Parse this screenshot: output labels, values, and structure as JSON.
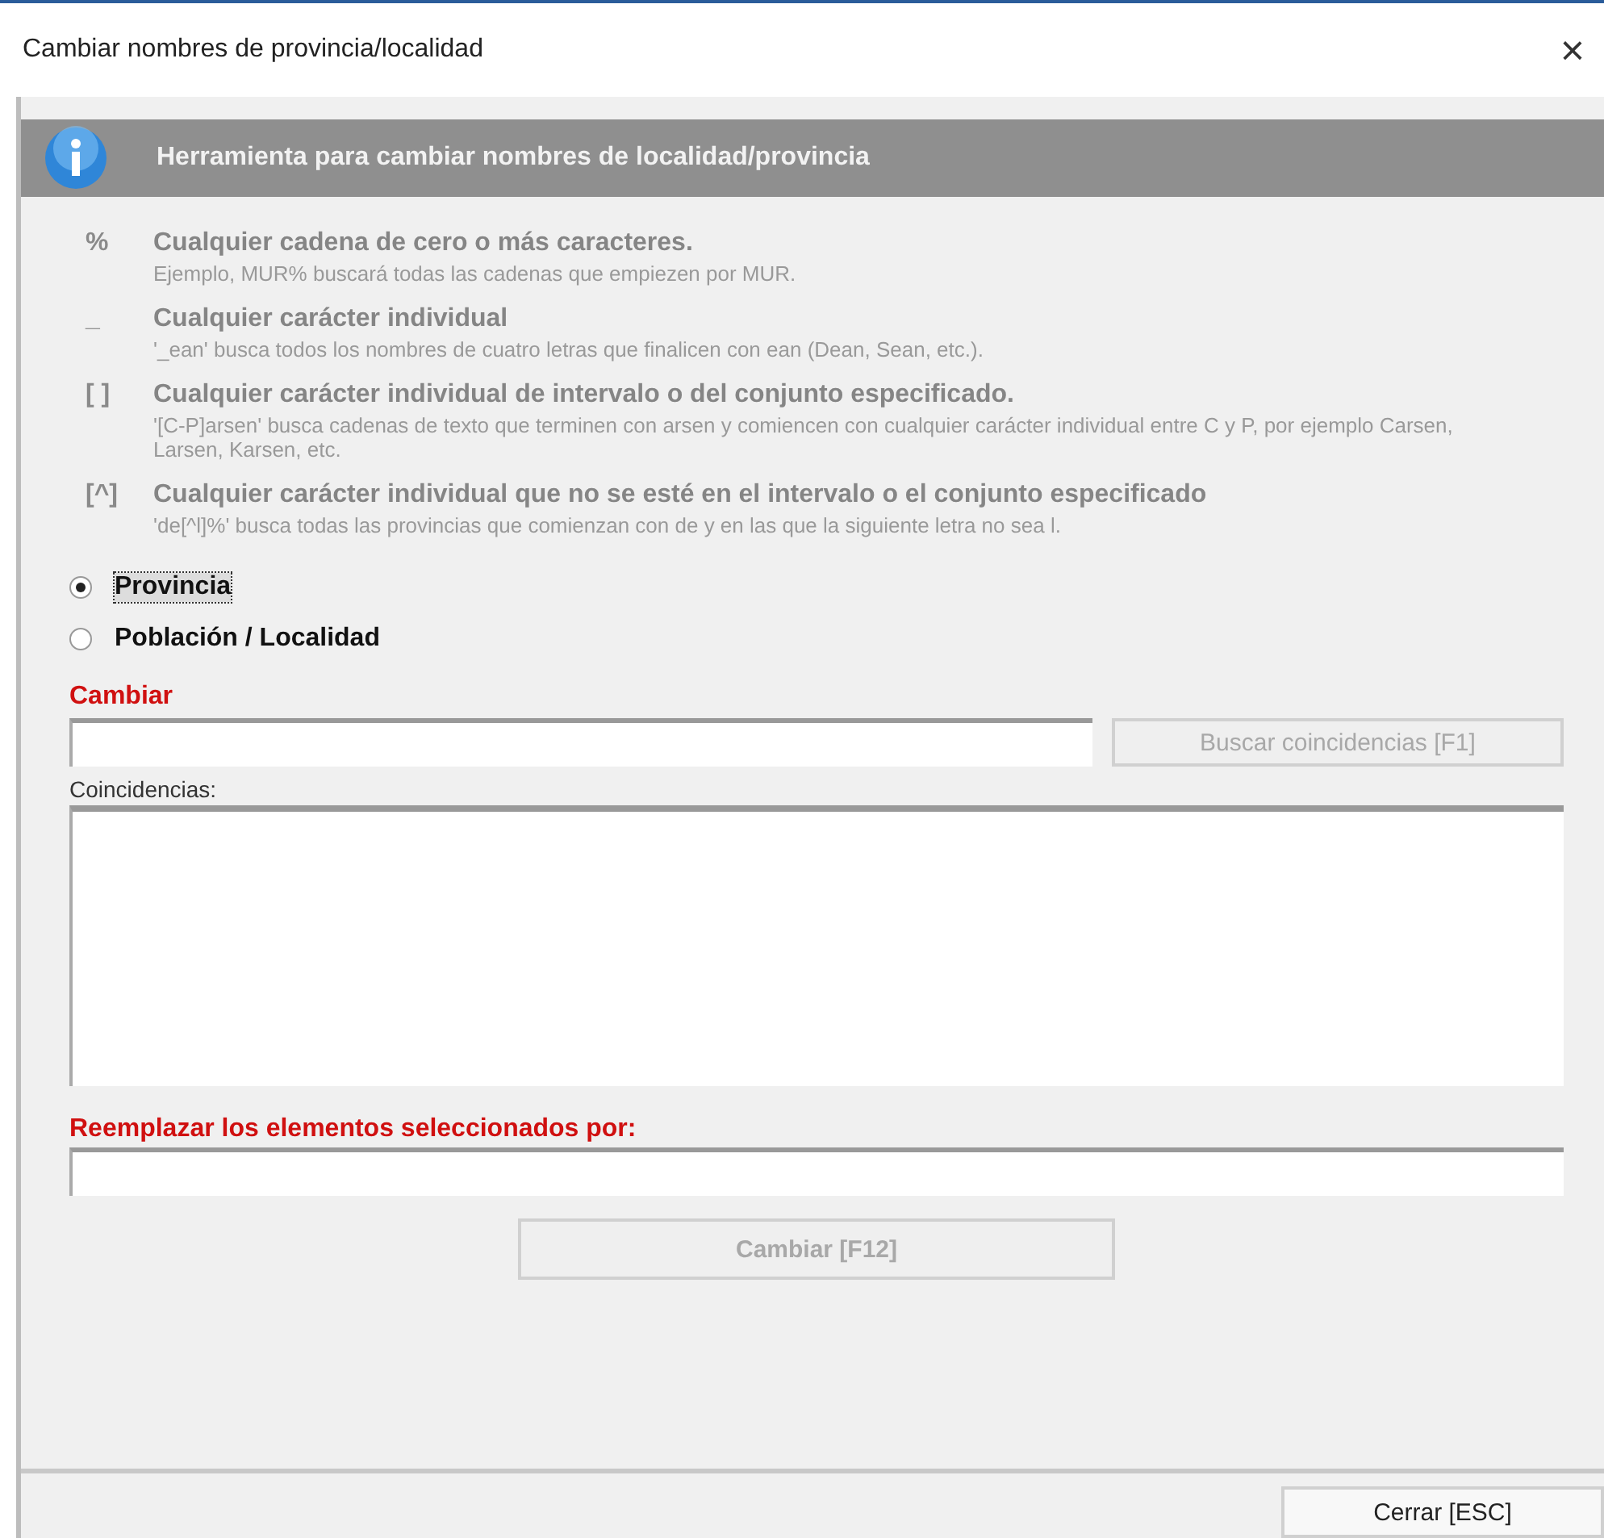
{
  "window": {
    "title": "Cambiar nombres de provincia/localidad",
    "close": "×"
  },
  "header": {
    "title": "Herramienta para cambiar nombres de localidad/provincia"
  },
  "wildcards": [
    {
      "symbol": "%",
      "title": "Cualquier cadena de cero o más caracteres.",
      "description": "Ejemplo, MUR% buscará todas las cadenas que empiezen por MUR."
    },
    {
      "symbol": "_",
      "title": "Cualquier carácter individual",
      "description": "'_ean' busca todos los nombres de cuatro letras que finalicen con ean (Dean, Sean, etc.)."
    },
    {
      "symbol": "[ ]",
      "title": "Cualquier carácter individual de intervalo o del conjunto especificado.",
      "description": "'[C-P]arsen' busca cadenas de texto que terminen con arsen y comiencen con cualquier carácter individual entre C y P, por ejemplo Carsen, Larsen, Karsen, etc."
    },
    {
      "symbol": "[^]",
      "title": "Cualquier carácter individual que no se esté en el intervalo o el conjunto especificado",
      "description": "'de[^l]%' busca todas las provincias que comienzan con de y en las que la siguiente letra no sea l."
    }
  ],
  "options": [
    {
      "label": "Provincia",
      "selected": true
    },
    {
      "label": "Población / Localidad",
      "selected": false
    }
  ],
  "change_label": "Cambiar",
  "search_button": {
    "label": "Buscar coincidencias [F1]",
    "disabled": true
  },
  "matches_label": "Coincidencias:",
  "replace_label": "Reemplazar los elementos seleccionados por:",
  "change_button": {
    "label": "Cambiar [F12]",
    "disabled": true
  },
  "close_button": {
    "label": "Cerrar [ESC]",
    "disabled": false
  }
}
